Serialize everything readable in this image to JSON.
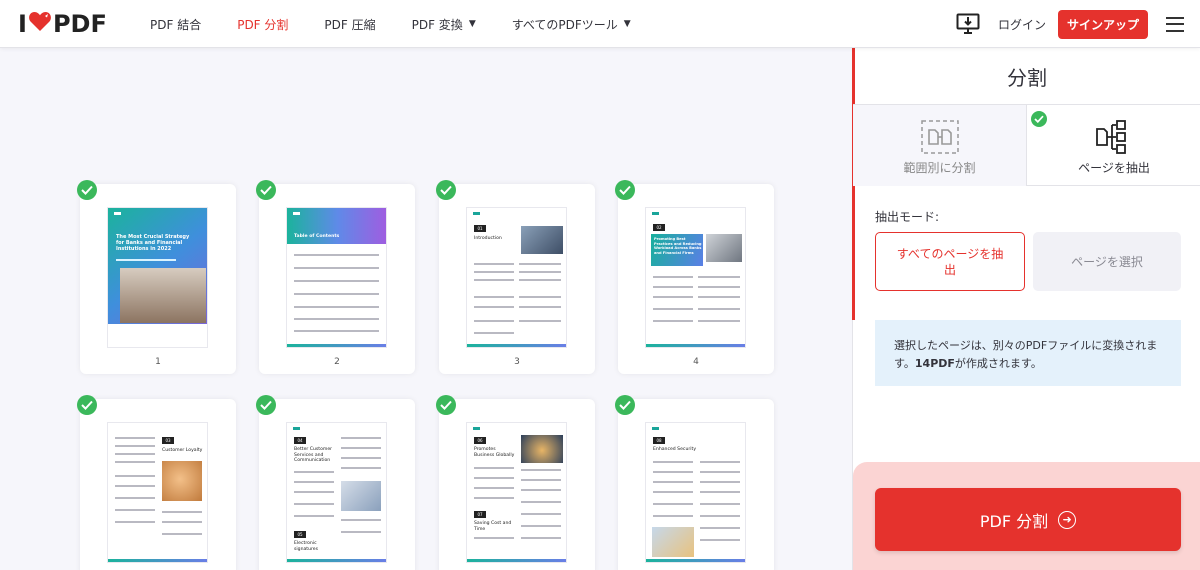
{
  "header": {
    "logo_text_left": "I",
    "logo_text_right": "PDF",
    "nav": [
      {
        "label": "PDF 結合",
        "active": false,
        "dropdown": false
      },
      {
        "label": "PDF 分割",
        "active": true,
        "dropdown": false
      },
      {
        "label": "PDF 圧縮",
        "active": false,
        "dropdown": false
      },
      {
        "label": "PDF 変換",
        "active": false,
        "dropdown": true
      },
      {
        "label": "すべてのPDFツール",
        "active": false,
        "dropdown": true
      }
    ],
    "login": "ログイン",
    "signup": "サインアップ",
    "icons": {
      "desktop": "desktop-download-icon",
      "menu": "hamburger-menu-icon"
    }
  },
  "pages": [
    {
      "number": "1",
      "cover_title": "The Most Crucial Strategy for Banks and Financial Institutions in 2022"
    },
    {
      "number": "2",
      "heading": "Table of Contents"
    },
    {
      "number": "3",
      "badge": "01",
      "heading": "Introduction"
    },
    {
      "number": "4",
      "badge": "02",
      "heading": "Promoting Best Practices and Reducing Workload Across Banks and Financial Firms"
    },
    {
      "number": "",
      "badge": "03",
      "heading": "Customer Loyalty"
    },
    {
      "number": "",
      "badge": "04",
      "heading": "Better Customer Services and Communication",
      "badge2": "05",
      "heading2": "Electronic signatures"
    },
    {
      "number": "",
      "badge": "06",
      "heading": "Promotes Business Globally",
      "badge2": "07",
      "heading2": "Saving Cost and Time"
    },
    {
      "number": "",
      "badge": "08",
      "heading": "Enhanced Security"
    }
  ],
  "panel": {
    "title": "分割",
    "tabs": [
      {
        "label": "範囲別に分割",
        "selected": false
      },
      {
        "label": "ページを抽出",
        "selected": true
      }
    ],
    "extract_mode_label": "抽出モード:",
    "options": [
      {
        "label": "すべてのページを抽出",
        "selected": true
      },
      {
        "label": "ページを選択",
        "selected": false
      }
    ],
    "info_text_1": "選択したページは、別々のPDFファイルに変換されます。",
    "info_bold": "14PDF",
    "info_text_2": "が作成されます。",
    "cta_label": "PDF 分割"
  },
  "colors": {
    "brand_red": "#e5322d",
    "check_green": "#3bb85b",
    "info_bg": "#e4f1fb",
    "cta_bg": "#fbd4d3"
  }
}
